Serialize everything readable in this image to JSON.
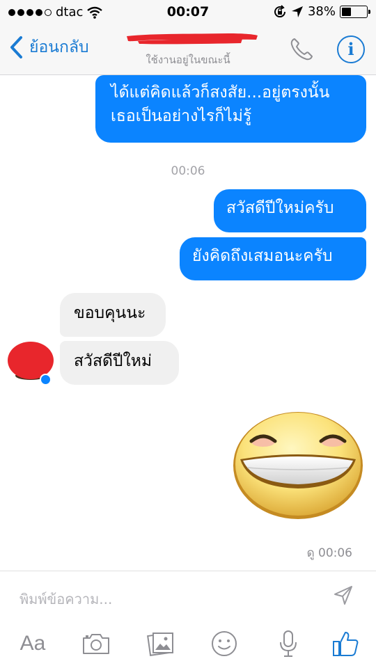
{
  "status_bar": {
    "carrier": "dtac",
    "time": "00:07",
    "battery_percent": "38%",
    "battery_level": 0.38
  },
  "nav": {
    "back_label": "ย้อนกลับ",
    "subtitle": "ใช้งานอยู่ในขณะนี้",
    "accent_color": "#1a7bd3"
  },
  "messages": {
    "out_1": "ได้แต่คิดแล้วก็สงสัย...อยู่ตรงนั้นเธอเป็นอย่างไรก็ไม่รู้",
    "timestamp_1": "00:06",
    "out_2": "สวัสดีปีใหม่ครับ",
    "out_3": "ยังคิดถึงเสมอนะครับ",
    "in_1": "ขอบคุนนะ",
    "in_2": "สวัสดีปีใหม่",
    "seen": "ดู 00:06",
    "outgoing_color": "#0b84ff",
    "incoming_color": "#f0f0f0"
  },
  "composer": {
    "placeholder": "พิมพ์ข้อความ...",
    "tools": {
      "text_label": "Aa",
      "icons": [
        "camera-icon",
        "photo-icon",
        "emoji-icon",
        "microphone-icon",
        "like-icon"
      ]
    }
  }
}
